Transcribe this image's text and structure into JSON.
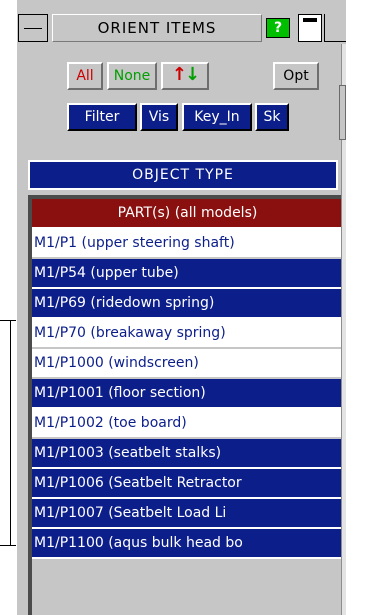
{
  "window": {
    "title": "ORIENT ITEMS",
    "help_label": "?"
  },
  "toolbar": {
    "all_label": "All",
    "none_label": "None",
    "swap_up": "↑",
    "swap_down": "↓",
    "opt_label": "Opt",
    "filter_label": "Filter",
    "vis_label": "Vis",
    "keyin_label": "Key_In",
    "sk_label": "Sk"
  },
  "section": {
    "header": "OBJECT TYPE"
  },
  "list": {
    "items": [
      {
        "label": "PART(s) (all models)",
        "state": "parts"
      },
      {
        "label": "M1/P1 (upper steering shaft)",
        "state": "unsel"
      },
      {
        "label": "M1/P54 (upper tube)",
        "state": "sel"
      },
      {
        "label": "M1/P69 (ridedown spring)",
        "state": "sel"
      },
      {
        "label": "M1/P70 (breakaway spring)",
        "state": "unsel"
      },
      {
        "label": "M1/P1000 (windscreen)",
        "state": "unsel"
      },
      {
        "label": "M1/P1001 (floor section)",
        "state": "sel"
      },
      {
        "label": "M1/P1002 (toe board)",
        "state": "unsel"
      },
      {
        "label": "M1/P1003 (seatbelt stalks)",
        "state": "sel"
      },
      {
        "label": "M1/P1006 (Seatbelt Retractor",
        "state": "sel"
      },
      {
        "label": "M1/P1007 (Seatbelt Load Li",
        "state": "sel"
      },
      {
        "label": "M1/P1100 (aqus bulk head bo",
        "state": "sel"
      }
    ]
  },
  "colors": {
    "panel_gray": "#c6c6c6",
    "selected_blue": "#0c1e8a",
    "parts_red": "#8a1010",
    "help_green": "#00bf00"
  }
}
